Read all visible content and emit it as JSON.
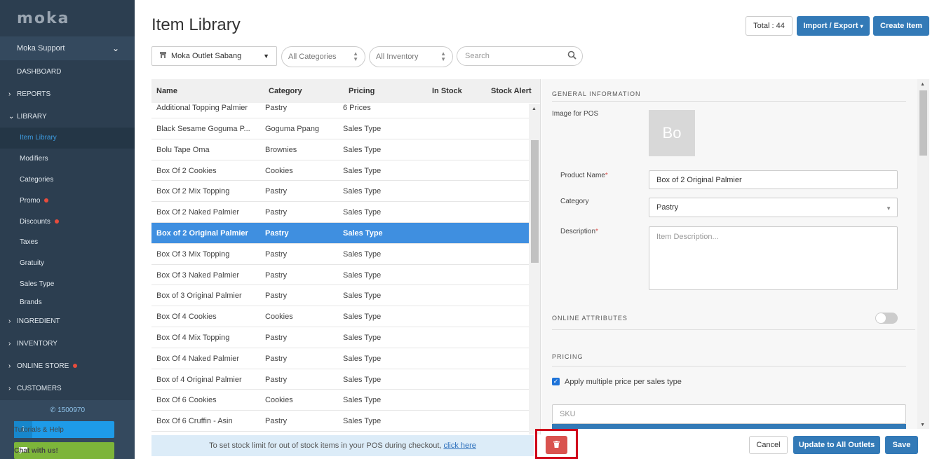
{
  "sidebar": {
    "logo": "moka",
    "account": "Moka Support",
    "dashboard": "DASHBOARD",
    "sections": {
      "reports": "REPORTS",
      "library": "LIBRARY",
      "ingredient": "INGREDIENT",
      "inventory": "INVENTORY",
      "online_store": "ONLINE STORE",
      "customers": "CUSTOMERS"
    },
    "library_items": [
      "Item Library",
      "Modifiers",
      "Categories",
      "Promo",
      "Discounts",
      "Taxes",
      "Gratuity",
      "Sales Type",
      "Brands"
    ],
    "phone": "1500970",
    "tutorials": "Tutorials & Help",
    "chat": "Chat with us!"
  },
  "header": {
    "title": "Item Library",
    "total": "Total : 44",
    "import_export": "Import / Export",
    "create_item": "Create Item"
  },
  "filters": {
    "outlet": "Moka Outlet Sabang",
    "category": "All Categories",
    "inventory": "All Inventory",
    "search_placeholder": "Search"
  },
  "table": {
    "headers": [
      "Name",
      "Category",
      "Pricing",
      "In Stock",
      "Stock Alert"
    ],
    "rows": [
      [
        "Additional Topping Palmier",
        "Pastry",
        "6 Prices"
      ],
      [
        "Black Sesame Goguma P...",
        "Goguma Ppang",
        "Sales Type"
      ],
      [
        "Bolu Tape Oma",
        "Brownies",
        "Sales Type"
      ],
      [
        "Box Of 2 Cookies",
        "Cookies",
        "Sales Type"
      ],
      [
        "Box Of 2 Mix Topping",
        "Pastry",
        "Sales Type"
      ],
      [
        "Box Of 2 Naked Palmier",
        "Pastry",
        "Sales Type"
      ],
      [
        "Box of 2 Original Palmier",
        "Pastry",
        "Sales Type"
      ],
      [
        "Box Of 3 Mix Topping",
        "Pastry",
        "Sales Type"
      ],
      [
        "Box Of 3 Naked Palmier",
        "Pastry",
        "Sales Type"
      ],
      [
        "Box of 3 Original Palmier",
        "Pastry",
        "Sales Type"
      ],
      [
        "Box Of 4 Cookies",
        "Cookies",
        "Sales Type"
      ],
      [
        "Box Of 4 Mix Topping",
        "Pastry",
        "Sales Type"
      ],
      [
        "Box Of 4 Naked Palmier",
        "Pastry",
        "Sales Type"
      ],
      [
        "Box of 4 Original Palmier",
        "Pastry",
        "Sales Type"
      ],
      [
        "Box Of 6 Cookies",
        "Cookies",
        "Sales Type"
      ],
      [
        "Box Of 6 Cruffin - Asin",
        "Pastry",
        "Sales Type"
      ]
    ],
    "selected_index": 6
  },
  "info_bar": {
    "text": "To set stock limit for out of stock items in your POS during checkout,",
    "link": "click here"
  },
  "panel": {
    "general_title": "GENERAL INFORMATION",
    "image_label": "Image for POS",
    "image_initials": "Bo",
    "product_name_label": "Product Name",
    "product_name_value": "Box of 2 Original Palmier",
    "category_label": "Category",
    "category_value": "Pastry",
    "description_label": "Description",
    "description_placeholder": "Item Description...",
    "online_title": "ONLINE ATTRIBUTES",
    "pricing_title": "PRICING",
    "multiple_price_label": "Apply multiple price per sales type",
    "sku_placeholder": "SKU",
    "required_mark": "*"
  },
  "footer": {
    "cancel": "Cancel",
    "update_all": "Update to All Outlets",
    "save": "Save"
  },
  "colors": {
    "sidebar_bg": "#2c3e50",
    "primary": "#337ab7",
    "selected_row": "#3f8fe0",
    "danger": "#d9534f",
    "highlight": "#d0021b"
  }
}
